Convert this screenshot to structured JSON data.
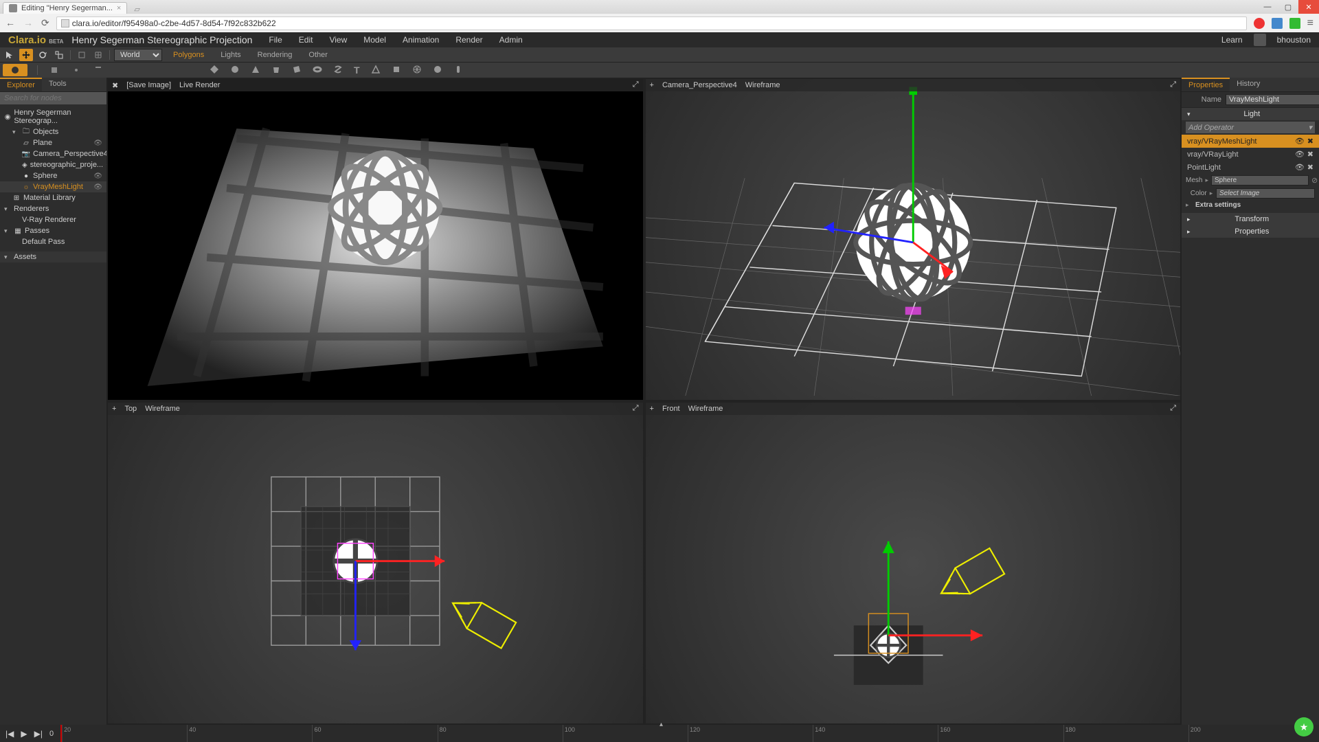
{
  "browser": {
    "tab_title": "Editing \"Henry Segerman...",
    "url": "clara.io/editor/f95498a0-c2be-4d57-8d54-7f92c832b622"
  },
  "app": {
    "logo": "Clara.io",
    "logo_beta": "BETA",
    "project_title": "Henry Segerman Stereographic Projection",
    "menus": [
      "File",
      "Edit",
      "View",
      "Model",
      "Animation",
      "Render",
      "Admin"
    ],
    "learn": "Learn",
    "username": "bhouston"
  },
  "toolrow": {
    "coord_space": "World",
    "subtools": [
      "Polygons",
      "Lights",
      "Rendering",
      "Other"
    ],
    "active_subtool": "Polygons"
  },
  "left": {
    "tabs": [
      "Explorer",
      "Tools"
    ],
    "active_tab": "Explorer",
    "search_placeholder": "Search for nodes",
    "root": "Henry Segerman Stereograp...",
    "objects_label": "Objects",
    "objects": [
      {
        "name": "Plane",
        "icon": "plane"
      },
      {
        "name": "Camera_Perspective4",
        "icon": "camera"
      },
      {
        "name": "stereographic_proje...",
        "icon": "mesh"
      },
      {
        "name": "Sphere",
        "icon": "sphere"
      },
      {
        "name": "VrayMeshLight",
        "icon": "light",
        "selected": true
      }
    ],
    "material_library": "Material Library",
    "renderers_label": "Renderers",
    "renderers": [
      "V-Ray Renderer"
    ],
    "passes_label": "Passes",
    "passes": [
      "Default Pass"
    ],
    "assets_label": "Assets"
  },
  "viewports": {
    "tl": {
      "close": "✖",
      "save": "[Save Image]",
      "live": "Live Render"
    },
    "tr": {
      "plus": "+",
      "camera": "Camera_Perspective4",
      "mode": "Wireframe"
    },
    "bl": {
      "plus": "+",
      "camera": "Top",
      "mode": "Wireframe"
    },
    "br": {
      "plus": "+",
      "camera": "Front",
      "mode": "Wireframe"
    }
  },
  "right": {
    "tabs": [
      "Properties",
      "History"
    ],
    "active_tab": "Properties",
    "name_label": "Name",
    "name_value": "VrayMeshLight",
    "light_section": "Light",
    "add_operator": "Add Operator",
    "operators": [
      {
        "name": "vray/VRayMeshLight",
        "selected": true
      },
      {
        "name": "vray/VRayLight"
      },
      {
        "name": "PointLight"
      }
    ],
    "mesh_label": "Mesh",
    "mesh_value": "Sphere",
    "color_label": "Color",
    "color_value": "Select Image",
    "extra_settings": "Extra settings",
    "transform_section": "Transform",
    "properties_section": "Properties"
  },
  "timeline": {
    "frame": "0",
    "ticks": [
      "20",
      "40",
      "60",
      "80",
      "100",
      "120",
      "140",
      "160",
      "180",
      "200"
    ]
  }
}
